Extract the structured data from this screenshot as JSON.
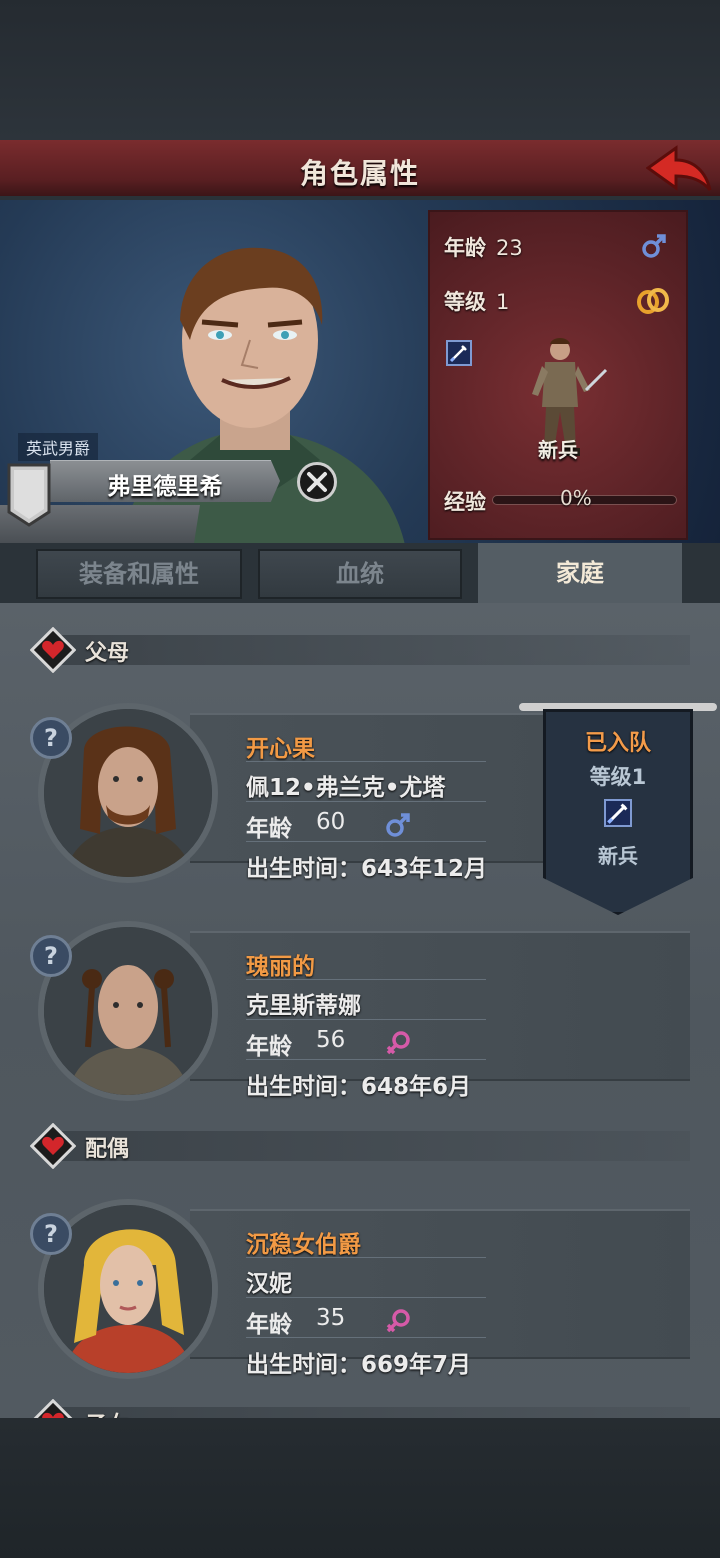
{
  "header": {
    "title": "角色属性"
  },
  "hero": {
    "rank_title": "英武男爵",
    "name": "弗里德里希",
    "stats": {
      "age_label": "年龄",
      "age": "23",
      "level_label": "等级",
      "level": "1",
      "class_name": "新兵",
      "xp_label": "经验",
      "xp_percent": "0%",
      "xp_fraction": 0
    }
  },
  "tabs": [
    {
      "label": "装备和属性"
    },
    {
      "label": "血统"
    },
    {
      "label": "家庭"
    }
  ],
  "family": {
    "parents_label": "父母",
    "spouse_label": "配偶",
    "children_label": "子女",
    "members": [
      {
        "title": "开心果",
        "name": "佩12•弗兰克•尤塔",
        "age_label": "年龄",
        "age": "60",
        "gender": "male",
        "birth": "出生时间：643年12月",
        "party": {
          "status": "已入队",
          "level": "等级1",
          "class_name": "新兵"
        }
      },
      {
        "title": "瑰丽的",
        "name": "克里斯蒂娜",
        "age_label": "年龄",
        "age": "56",
        "gender": "female",
        "birth": "出生时间：648年6月"
      },
      {
        "title": "沉稳女伯爵",
        "name": "汉妮",
        "age_label": "年龄",
        "age": "35",
        "gender": "female",
        "birth": "出生时间：669年7月"
      }
    ]
  },
  "colors": {
    "accent_orange": "#f29a45",
    "male_blue": "#6f8fd8",
    "female_pink": "#d65aa8",
    "header_red": "#6a2528"
  }
}
